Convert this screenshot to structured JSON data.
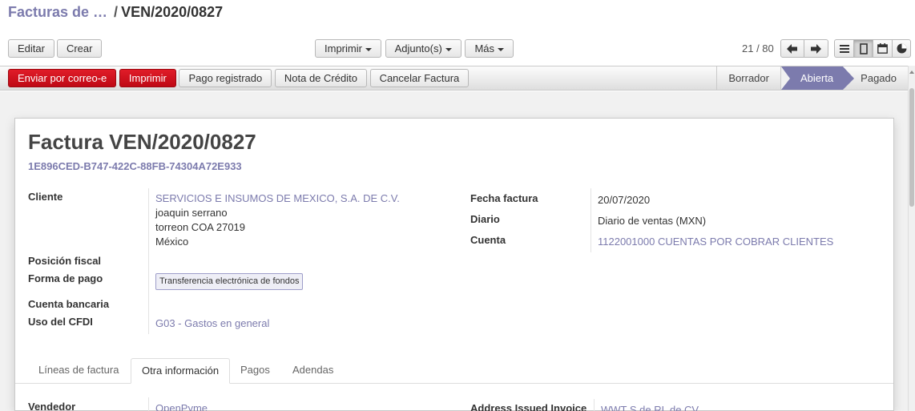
{
  "breadcrumb": {
    "parent": "Facturas de …",
    "separator": "/",
    "current": "VEN/2020/0827"
  },
  "toolbar": {
    "edit": "Editar",
    "create": "Crear",
    "print": "Imprimir",
    "attachments": "Adjunto(s)",
    "more": "Más"
  },
  "pager": {
    "value": "21 / 80"
  },
  "view_switcher": [
    "list-icon",
    "form-icon",
    "calendar-icon",
    "graph-icon"
  ],
  "status_actions": {
    "send_email": "Enviar por correo-e",
    "print": "Imprimir",
    "register_payment": "Pago registrado",
    "credit_note": "Nota de Crédito",
    "cancel_invoice": "Cancelar Factura"
  },
  "stages": [
    "Borrador",
    "Abierta",
    "Pagado"
  ],
  "active_stage": "Abierta",
  "document": {
    "title_prefix": "Factura",
    "title_number": "VEN/2020/0827",
    "uuid": "1E896CED-B747-422C-88FB-74304A72E933"
  },
  "fields_left": {
    "customer_label": "Cliente",
    "customer_name": "SERVICIOS E INSUMOS DE MEXICO, S.A. DE C.V.",
    "customer_contact": "joaquin serrano",
    "customer_city": "torreon COA 27019",
    "customer_country": "México",
    "fiscal_position_label": "Posición fiscal",
    "payment_method_label": "Forma de pago",
    "payment_method_value": "Transferencia electrónica de fondos",
    "bank_account_label": "Cuenta bancaria",
    "cfdi_use_label": "Uso del CFDI",
    "cfdi_use_value": "G03 - Gastos en general"
  },
  "fields_right": {
    "invoice_date_label": "Fecha factura",
    "invoice_date_value": "20/07/2020",
    "journal_label": "Diario",
    "journal_value": "Diario de ventas (MXN)",
    "account_label": "Cuenta",
    "account_value": "1122001000 CUENTAS POR COBRAR CLIENTES"
  },
  "tabs": [
    "Líneas de factura",
    "Otra información",
    "Pagos",
    "Adendas"
  ],
  "other_info": {
    "salesperson_label": "Vendedor",
    "salesperson_value": "OpenPyme",
    "address_label": "Address Issued Invoice",
    "address_value": "WWT S de RL de CV"
  },
  "colors": {
    "accent": "#7c7bad",
    "primary_red": "#d0121d",
    "sheet_bg": "#f1f1f1"
  }
}
